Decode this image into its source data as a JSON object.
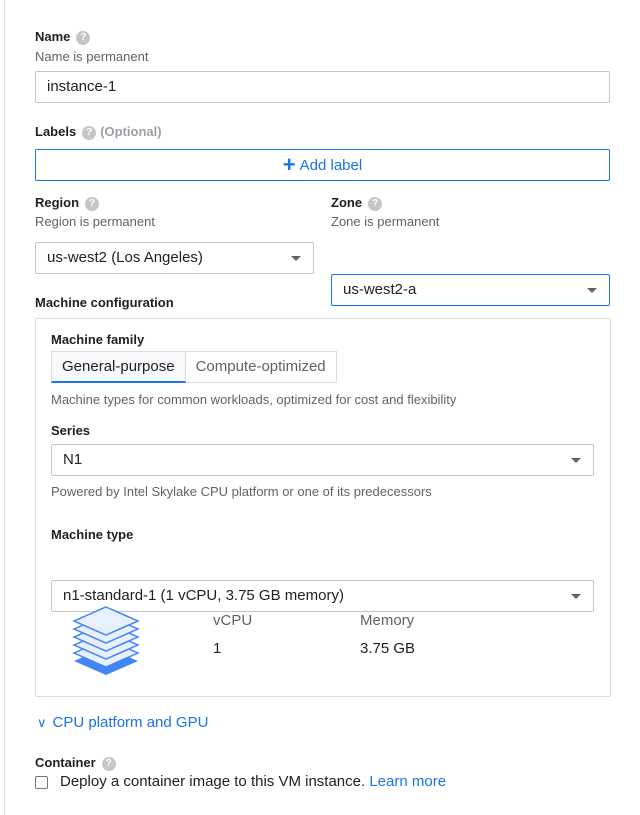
{
  "name": {
    "label": "Name",
    "help": "?",
    "hint": "Name is permanent",
    "value": "instance-1"
  },
  "labels": {
    "label": "Labels",
    "help": "?",
    "optional": "(Optional)",
    "add_button": "Add label"
  },
  "region": {
    "label": "Region",
    "help": "?",
    "hint": "Region is permanent",
    "value": "us-west2 (Los Angeles)"
  },
  "zone": {
    "label": "Zone",
    "help": "?",
    "hint": "Zone is permanent",
    "value": "us-west2-a"
  },
  "machine_config": {
    "label": "Machine configuration",
    "family": {
      "label": "Machine family",
      "tabs": [
        "General-purpose",
        "Compute-optimized"
      ],
      "selected": "General-purpose",
      "description": "Machine types for common workloads, optimized for cost and flexibility"
    },
    "series": {
      "label": "Series",
      "value": "N1",
      "description": "Powered by Intel Skylake CPU platform or one of its predecessors"
    },
    "machine_type": {
      "label": "Machine type",
      "value": "n1-standard-1 (1 vCPU, 3.75 GB memory)",
      "vcpu_header": "vCPU",
      "vcpu_value": "1",
      "memory_header": "Memory",
      "memory_value": "3.75 GB"
    }
  },
  "cpu_gpu_link": "CPU platform and GPU",
  "container": {
    "label": "Container",
    "help": "?",
    "checkbox_text": "Deploy a container image to this VM instance.",
    "learn_more": "Learn more",
    "checked": false
  },
  "colors": {
    "accent": "#1a73e8",
    "stack_light": "#e8f0fe",
    "stack_border": "#4285f4"
  }
}
